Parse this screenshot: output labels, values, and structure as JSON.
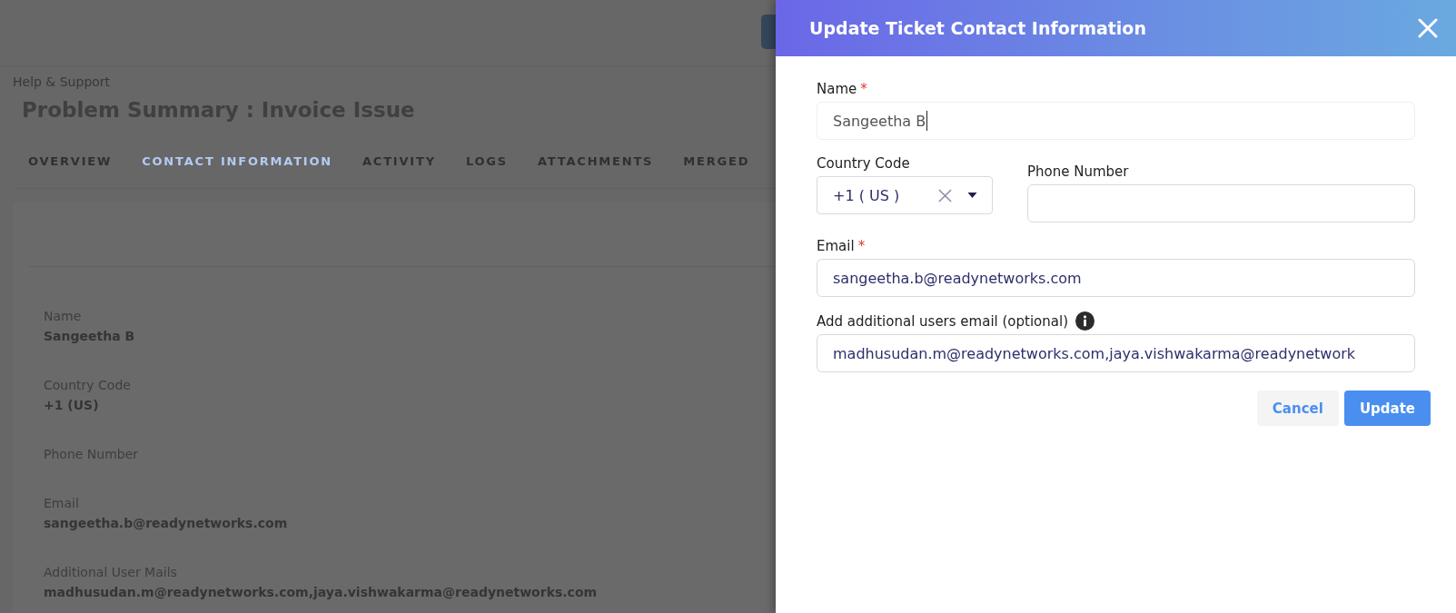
{
  "page": {
    "breadcrumb": "Help & Support",
    "title": "Problem Summary : Invoice Issue",
    "tabs": [
      {
        "label": "OVERVIEW",
        "selected": false
      },
      {
        "label": "CONTACT INFORMATION",
        "selected": true
      },
      {
        "label": "ACTIVITY",
        "selected": false
      },
      {
        "label": "LOGS",
        "selected": false
      },
      {
        "label": "ATTACHMENTS",
        "selected": false
      },
      {
        "label": "MERGED",
        "selected": false
      }
    ],
    "details": [
      {
        "label": "Name",
        "value": "Sangeetha B"
      },
      {
        "label": "Country Code",
        "value": "+1 (US)"
      },
      {
        "label": "Phone Number"
      },
      {
        "label": "Email",
        "value": "sangeetha.b@readynetworks.com"
      },
      {
        "label": "Additional User Mails",
        "value": "madhusudan.m@readynetworks.com,jaya.vishwakarma@readynetworks.com"
      }
    ]
  },
  "dialog": {
    "title": "Update Ticket Contact Information",
    "rows": [
      {
        "fields": [
          {
            "kind": "text",
            "label": "Name",
            "required_mark": "*",
            "value": "Sangeetha B",
            "focused": true
          }
        ]
      },
      {
        "fields": [
          {
            "kind": "select",
            "label": "Country Code",
            "value": "+1 ( US )",
            "focused": false
          },
          {
            "kind": "text",
            "label": "Phone Number",
            "focused": false
          }
        ]
      },
      {
        "fields": [
          {
            "kind": "text",
            "label": "Email",
            "required_mark": "*",
            "value": "sangeetha.b@readynetworks.com",
            "focused": false
          }
        ]
      },
      {
        "fields": [
          {
            "kind": "text",
            "label": "Add additional users email (optional)",
            "value": "madhusudan.m@readynetworks.com,jaya.vishwakarma@readynetwork",
            "focused": false,
            "info": true
          }
        ]
      }
    ],
    "buttons": [
      {
        "label": "Cancel",
        "kind": "secondary"
      },
      {
        "label": "Update",
        "kind": "primary"
      }
    ]
  }
}
